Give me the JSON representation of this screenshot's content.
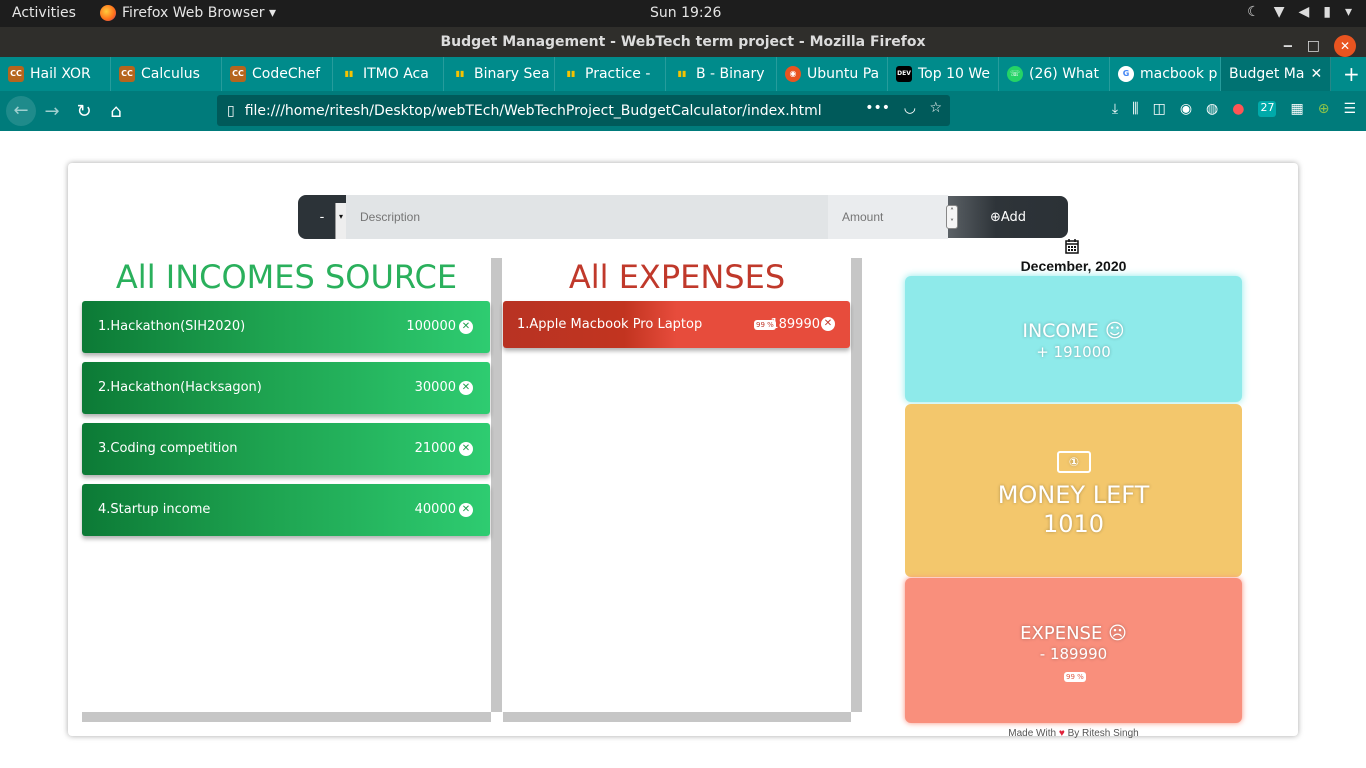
{
  "system": {
    "activities": "Activities",
    "app_name": "Firefox Web Browser ▾",
    "clock": "Sun 19:26"
  },
  "window": {
    "title": "Budget Management - WebTech term project - Mozilla Firefox"
  },
  "tabs": [
    {
      "label": "Hail XOR",
      "icon": "codechef-icon",
      "color": "#b5651d",
      "icon_text": "CC"
    },
    {
      "label": "Calculus",
      "icon": "codechef-icon",
      "color": "#b5651d",
      "icon_text": "CC"
    },
    {
      "label": "CodeChef",
      "icon": "codechef-icon",
      "color": "#b5651d",
      "icon_text": "CC"
    },
    {
      "label": "ITMO Aca",
      "icon": "codeforces-icon",
      "color": "#1a7bbf",
      "icon_text": "▮▮"
    },
    {
      "label": "Binary Sea",
      "icon": "codeforces-icon",
      "color": "#1a7bbf",
      "icon_text": "▮▮"
    },
    {
      "label": "Practice -",
      "icon": "codeforces-icon",
      "color": "#1a7bbf",
      "icon_text": "▮▮"
    },
    {
      "label": "B - Binary",
      "icon": "codeforces-icon",
      "color": "#1a7bbf",
      "icon_text": "▮▮"
    },
    {
      "label": "Ubuntu Pa",
      "icon": "ubuntu-icon",
      "color": "#e95420",
      "icon_text": "◉"
    },
    {
      "label": "Top 10 We",
      "icon": "dev-icon",
      "color": "#000000",
      "icon_text": "DEV"
    },
    {
      "label": "(26) What",
      "icon": "whatsapp-icon",
      "color": "#25d366",
      "icon_text": "☏"
    },
    {
      "label": "macbook p",
      "icon": "google-icon",
      "color": "#ffffff",
      "icon_text": "G"
    },
    {
      "label": "Budget Ma",
      "icon": "",
      "color": "",
      "icon_text": ""
    }
  ],
  "navbar": {
    "url": "file:///home/ritesh/Desktop/webTEch/WebTechProject_BudgetCalculator/index.html",
    "badge_count": "27"
  },
  "form": {
    "type_value": "-",
    "description_placeholder": "Description",
    "amount_placeholder": "Amount",
    "add_label": "Add"
  },
  "incomes": {
    "heading": "All INCOMES SOURCE",
    "items": [
      {
        "desc": "1.Hackathon(SIH2020)",
        "value": "100000"
      },
      {
        "desc": "2.Hackathon(Hacksagon)",
        "value": "30000"
      },
      {
        "desc": "3.Coding competition",
        "value": "21000"
      },
      {
        "desc": "4.Startup income",
        "value": "40000"
      }
    ]
  },
  "expenses": {
    "heading": "All EXPENSES",
    "items": [
      {
        "desc": "1.Apple Macbook Pro Laptop",
        "percent": "99 %",
        "value": "189990"
      }
    ]
  },
  "summary": {
    "date": "December, 2020",
    "income_label": "INCOME ☺",
    "income_value": "+ 191000",
    "money_left_label": "MONEY LEFT",
    "money_left_value": "1010",
    "expense_label": "EXPENSE ☹",
    "expense_value": "- 189990",
    "expense_percent": "99 %"
  },
  "footer": {
    "made_with": "Made With",
    "by": "By Ritesh Singh"
  },
  "colors": {
    "income": "#2ab05c",
    "expense": "#c0392b",
    "income_box": "#8eeaea",
    "money_left_box": "#f3c76c",
    "expense_box": "#f98f7c",
    "browser_accent": "#008b8b"
  }
}
